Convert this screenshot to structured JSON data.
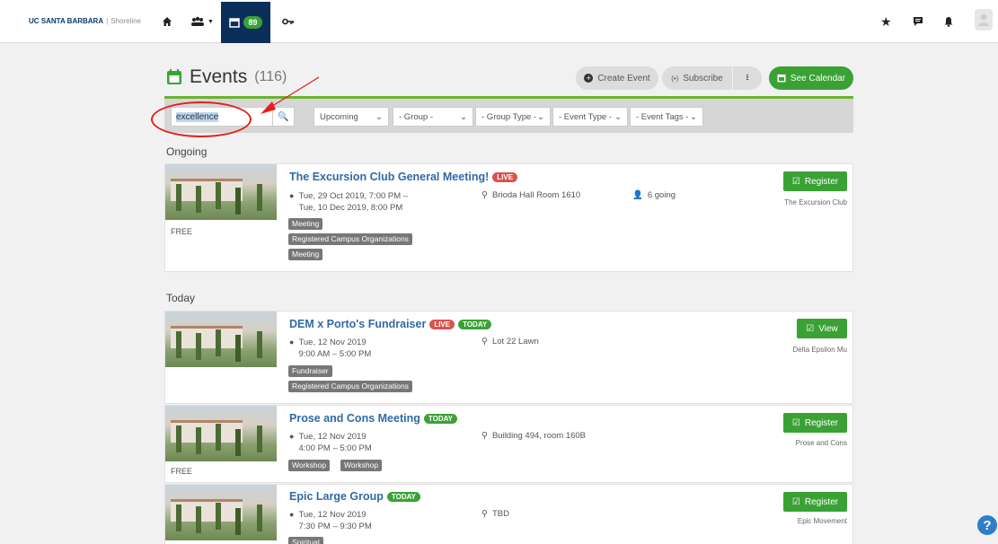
{
  "brand": {
    "name": "UC SANTA BARBARA",
    "sub": "Shoreline"
  },
  "nav": {
    "events_count": "89"
  },
  "header": {
    "title": "Events",
    "count": "(116)",
    "create": "Create Event",
    "subscribe": "Subscribe",
    "calendar": "See Calendar"
  },
  "filters": {
    "search_value": "excellence",
    "when": "Upcoming",
    "group": "- Group -",
    "group_type": "- Group Type -",
    "event_type": "- Event Type -",
    "event_tags": "- Event Tags -"
  },
  "sections": {
    "ongoing": "Ongoing",
    "today": "Today"
  },
  "events": [
    {
      "title": "The Excursion Club General Meeting!",
      "live": "LIVE",
      "today": "",
      "date1": "Tue, 29 Oct 2019, 7:00 PM –",
      "date2": "Tue, 10 Dec 2019, 8:00 PM",
      "location": "Brioda Hall Room 1610",
      "going": "6 going",
      "free": "FREE",
      "tags": [
        "Meeting",
        "Registered Campus Organizations",
        "Meeting"
      ],
      "action": "Register",
      "org": "The Excursion Club"
    },
    {
      "title": "DEM x Porto's Fundraiser",
      "live": "LIVE",
      "today": "TODAY",
      "date1": "Tue, 12 Nov 2019",
      "date2": "9:00 AM – 5:00 PM",
      "location": "Lot 22 Lawn",
      "going": "",
      "free": "",
      "tags": [
        "Fundraiser",
        "Registered Campus Organizations"
      ],
      "action": "View",
      "org": "Delta Epsilon Mu"
    },
    {
      "title": "Prose and Cons Meeting",
      "live": "",
      "today": "TODAY",
      "date1": "Tue, 12 Nov 2019",
      "date2": "4:00 PM – 5:00 PM",
      "location": "Building 494, room 160B",
      "going": "",
      "free": "FREE",
      "tags": [
        "Workshop",
        "Workshop"
      ],
      "action": "Register",
      "org": "Prose and Cons"
    },
    {
      "title": "Epic Large Group",
      "live": "",
      "today": "TODAY",
      "date1": "Tue, 12 Nov 2019",
      "date2": "7:30 PM – 9:30 PM",
      "location": "TBD",
      "going": "",
      "free": "",
      "tags": [
        "Spiritual"
      ],
      "action": "Register",
      "org": "Epic Movement"
    }
  ],
  "help": "?"
}
